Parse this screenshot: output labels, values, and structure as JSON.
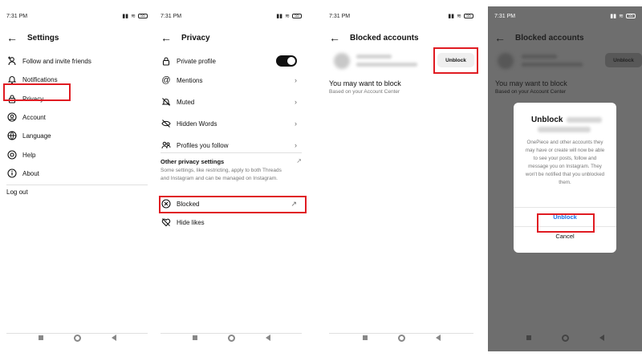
{
  "status": {
    "time": "7:31 PM",
    "battery": "55"
  },
  "screen1": {
    "title": "Settings",
    "items": [
      {
        "label": "Follow and invite friends",
        "icon": "add-person-icon"
      },
      {
        "label": "Notifications",
        "icon": "bell-icon"
      },
      {
        "label": "Privacy",
        "icon": "lock-icon"
      },
      {
        "label": "Account",
        "icon": "account-icon"
      },
      {
        "label": "Language",
        "icon": "globe-icon"
      },
      {
        "label": "Help",
        "icon": "help-icon"
      },
      {
        "label": "About",
        "icon": "info-icon"
      }
    ],
    "logout": "Log out"
  },
  "screen2": {
    "title": "Privacy",
    "items": [
      {
        "label": "Private profile",
        "icon": "lock-icon"
      },
      {
        "label": "Mentions",
        "icon": "at-icon"
      },
      {
        "label": "Muted",
        "icon": "bell-off-icon"
      },
      {
        "label": "Hidden Words",
        "icon": "eye-off-icon"
      },
      {
        "label": "Profiles you follow",
        "icon": "people-icon"
      }
    ],
    "other_title": "Other privacy settings",
    "other_desc": "Some settings, like restricting, apply to both Threads and Instagram and can be managed on Instagram.",
    "blocked": "Blocked",
    "hide_likes": "Hide likes",
    "private_toggle_on": true
  },
  "screen3": {
    "title": "Blocked accounts",
    "unblock_label": "Unblock",
    "suggest_title": "You may want to block",
    "suggest_sub": "Based on your Account Center"
  },
  "screen4": {
    "title": "Blocked accounts",
    "unblock_label": "Unblock",
    "suggest_title": "You may want to block",
    "suggest_sub": "Based on your Account Center",
    "dialog": {
      "title": "Unblock",
      "body": "OnePiece and other accounts they may have or create will now be able to see your posts, follow and message you on Instagram. They won't be notified that you unblocked them.",
      "confirm": "Unblock",
      "cancel": "Cancel"
    }
  },
  "colors": {
    "highlight": "#e01b22",
    "link": "#1a73e8",
    "overlay": "#6e6e6e"
  }
}
